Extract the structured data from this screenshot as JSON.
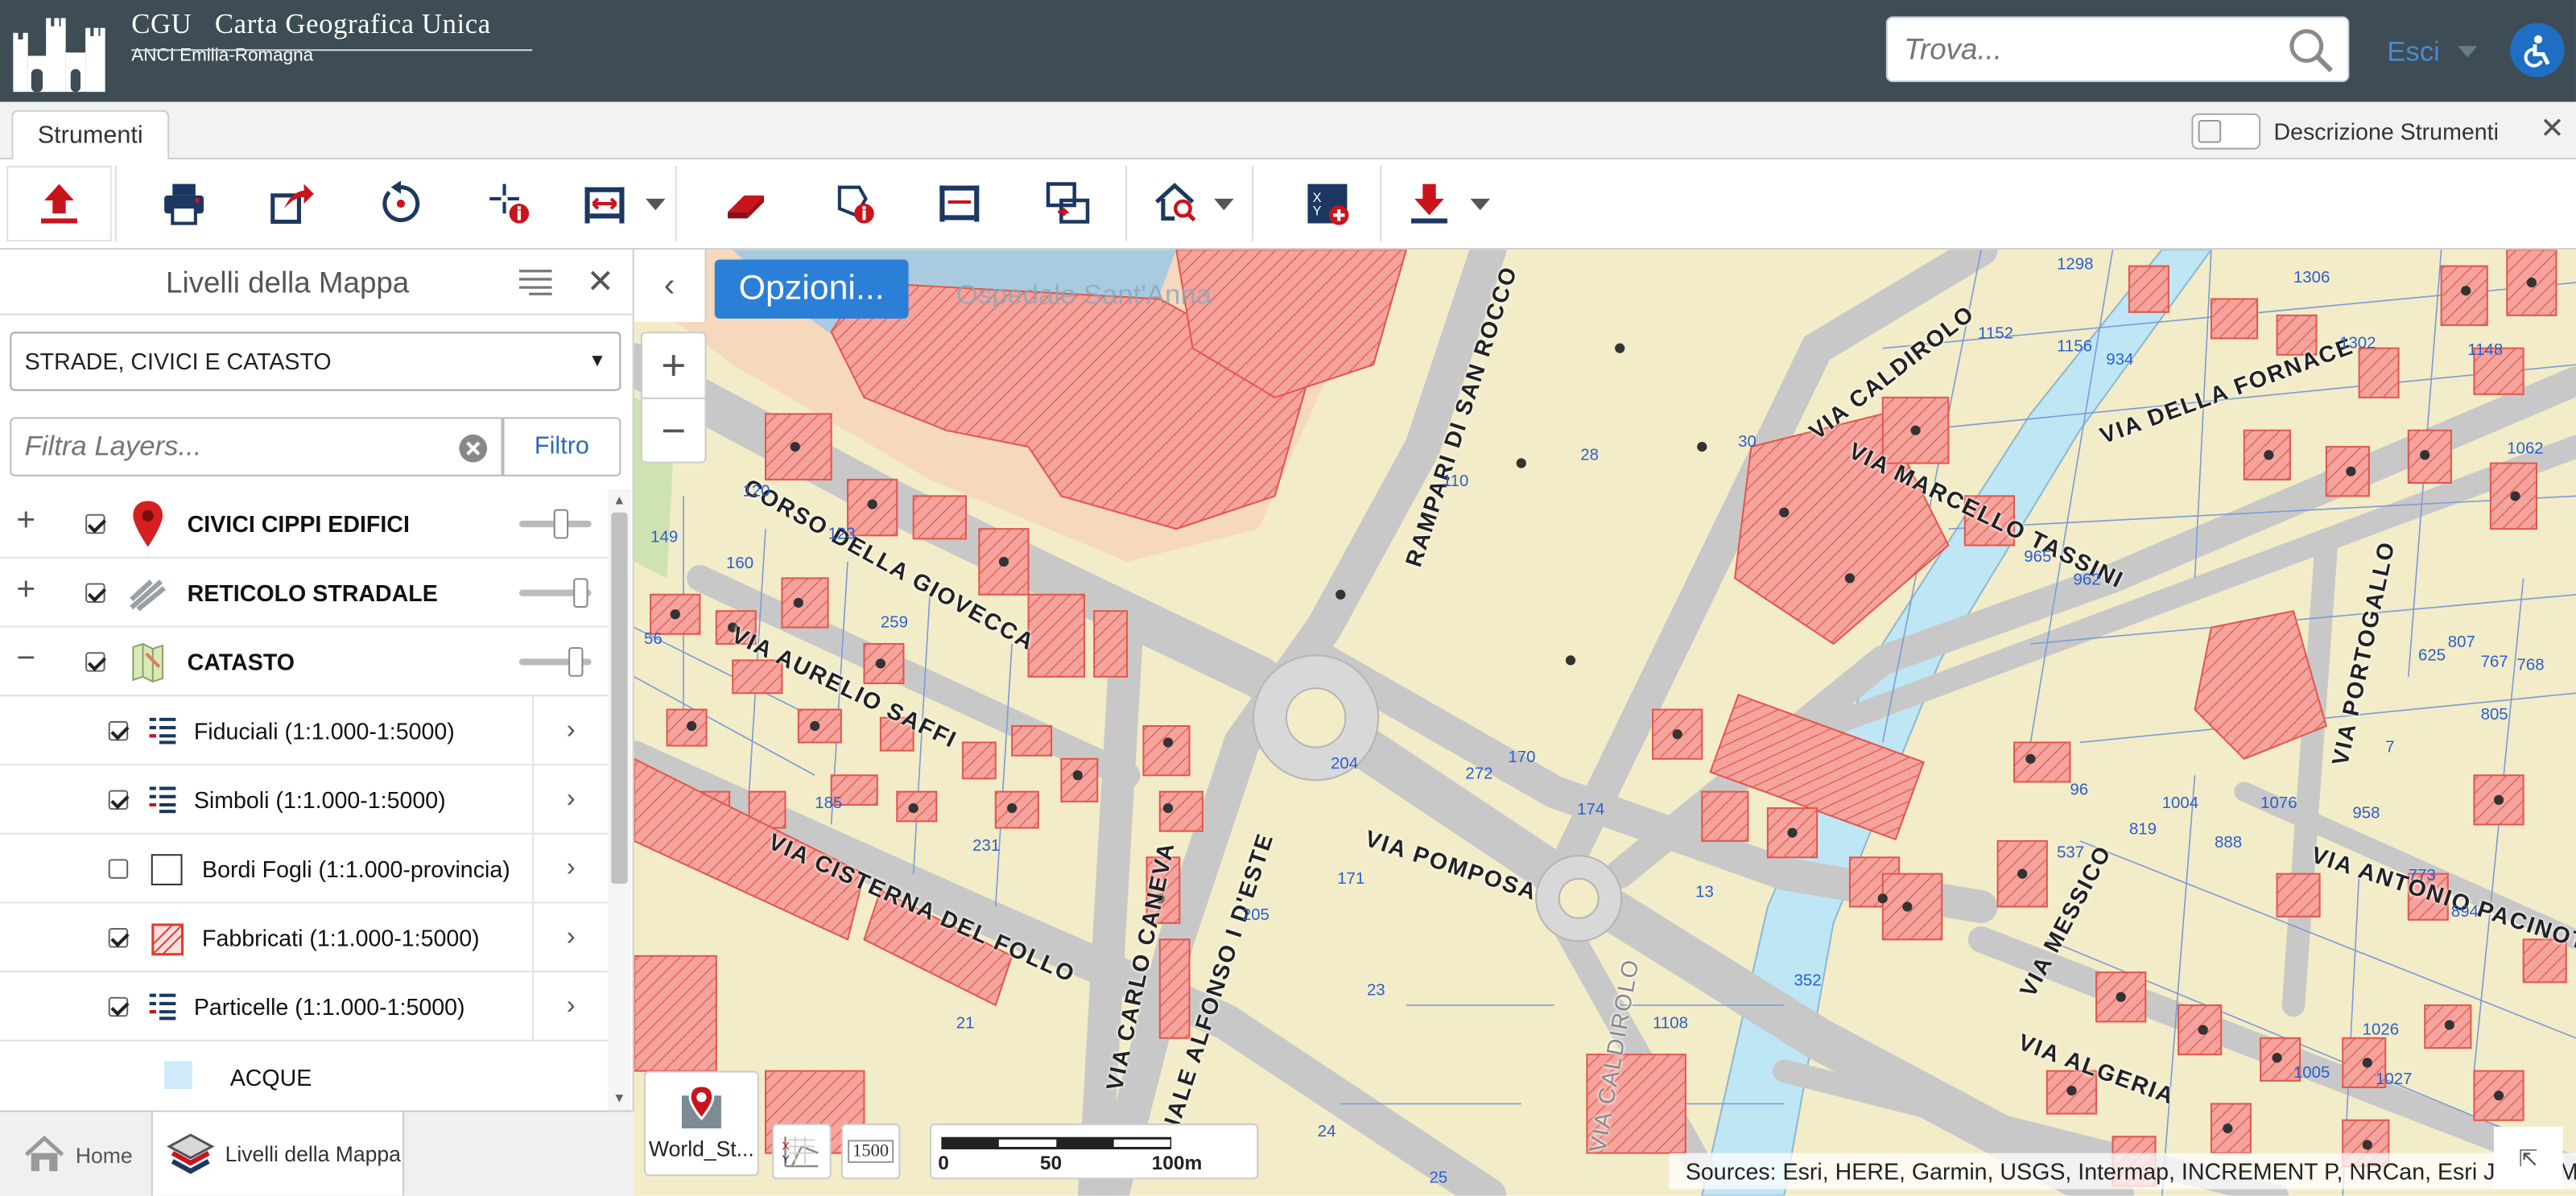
{
  "header": {
    "brand_title_a": "CGU",
    "brand_title_b": "Carta Geografica Unica",
    "brand_subtitle": "ANCI Emilia-Romagna",
    "search_placeholder": "Trova...",
    "logout_label": "Esci"
  },
  "tabs": {
    "tools_tab": "Strumenti",
    "tool_descriptions_label": "Descrizione Strumenti"
  },
  "toolbar": {
    "icons": [
      "upload-icon",
      "print-icon",
      "share-icon",
      "reset-icon",
      "identify-point-icon",
      "measure-distance-icon",
      "eraser-icon",
      "identify-shape-icon",
      "measure-area-icon",
      "compare-icon",
      "address-search-icon",
      "coordinates-add-icon",
      "download-icon"
    ]
  },
  "panel": {
    "title": "Livelli della Mappa",
    "selected_group": "STRADE, CIVICI E CATASTO",
    "filter_placeholder": "Filtra Layers...",
    "filter_button": "Filtro",
    "layers": [
      {
        "name": "CIVICI CIPPI EDIFICI",
        "checked": true,
        "expander": "+",
        "opacity": 0.6
      },
      {
        "name": "RETICOLO STRADALE",
        "checked": true,
        "expander": "+",
        "opacity": 0.95
      },
      {
        "name": "CATASTO",
        "checked": true,
        "expander": "−",
        "opacity": 0.85
      }
    ],
    "sublayers": [
      {
        "name": "Fiduciali (1:1.000-1:5000)",
        "checked": true
      },
      {
        "name": "Simboli (1:1.000-1:5000)",
        "checked": true
      },
      {
        "name": "Bordi Fogli (1:1.000-provincia)",
        "checked": false
      },
      {
        "name": "Fabbricati (1:1.000-1:5000)",
        "checked": true
      },
      {
        "name": "Particelle (1:1.000-1:5000)",
        "checked": true
      }
    ],
    "legend_item": "ACQUE"
  },
  "bottom_tabs": {
    "home": "Home",
    "layers": "Livelli della Mappa"
  },
  "map": {
    "options_button": "Opzioni...",
    "basemap_label": "World_St...",
    "scale_input": "1500",
    "scale_ticks": [
      "0",
      "50",
      "100m"
    ],
    "attribution": "Sources: Esri, HERE, Garmin, USGS, Intermap, INCREMENT P, NRCan, Esri Japan, METI",
    "faded_label": "Ospedale Sant'Anna",
    "street_labels": [
      "CORSO DELLA GIOVECCA",
      "VIA AURELIO SAFFI",
      "VIA CISTERNA DEL FOLLO",
      "VIA CARLO CANEVA",
      "VIALE ALFONSO I D'ESTE",
      "RAMPARI DI SAN ROCCO",
      "VIA POMPOSA",
      "VIA CALDIROLO",
      "VIA MARCELLO TASSINI",
      "VIA DELLA FORNACE",
      "VIA PORTOGALLO",
      "VIA ANTONIO PACINOTTI",
      "VIA MESSICO",
      "VIA ALGERIA",
      "VIA CALDIROLO"
    ],
    "parcel_numbers": [
      "28",
      "30",
      "120",
      "160",
      "110",
      "204",
      "272",
      "170",
      "174",
      "23",
      "352",
      "1108",
      "24",
      "25",
      "1298",
      "1306",
      "1152",
      "1156",
      "934",
      "1302",
      "1148",
      "1062",
      "962",
      "965",
      "1004",
      "1076",
      "958",
      "894",
      "819",
      "888",
      "773",
      "807",
      "767",
      "768",
      "625",
      "805",
      "7",
      "96",
      "537",
      "1026",
      "1005",
      "1027",
      "21",
      "13",
      "205",
      "171",
      "259",
      "231",
      "185",
      "123",
      "149",
      "56"
    ]
  },
  "colors": {
    "header_bg": "#3d4c55",
    "accent": "#2c7fd6",
    "tool_red": "#c9141c",
    "tool_navy": "#1c3760",
    "building_fill": "#f4a39d",
    "map_bg": "#f3ecc8",
    "water": "#bfe6f5"
  }
}
